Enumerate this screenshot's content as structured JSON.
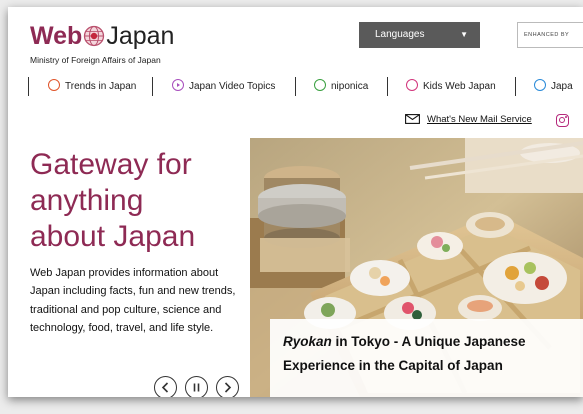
{
  "header": {
    "logo_web": "Web",
    "logo_japan": "Japan",
    "ministry": "Ministry of Foreign Affairs of Japan",
    "languages_label": "Languages",
    "search_label": "ENHANCED BY"
  },
  "nav": {
    "items": [
      {
        "label": "Trends in Japan",
        "icon": "trends-icon",
        "color": "#e0552b"
      },
      {
        "label": "Japan Video Topics",
        "icon": "video-icon",
        "color": "#a84fbd"
      },
      {
        "label": "niponica",
        "icon": "niponica-icon",
        "color": "#3aa040"
      },
      {
        "label": "Kids Web Japan",
        "icon": "kids-icon",
        "color": "#d2357c"
      },
      {
        "label": "Japa",
        "icon": "japan-icon",
        "color": "#2a8ad8"
      }
    ]
  },
  "whatsnew": {
    "label": "What's New Mail Service"
  },
  "hero": {
    "title_lines": [
      "Gateway for",
      "anything",
      "about Japan"
    ],
    "description": "Web Japan provides information about Japan including facts, fun and new trends, traditional and pop culture, science and technology, food, travel, and life style.",
    "caption_emph": "Ryokan",
    "caption_rest1": " in Tokyo - A Unique Japanese",
    "caption_line2": "Experience in the Capital of Japan"
  },
  "colors": {
    "brand": "#8e2a54",
    "language_button": "#5a5a5a",
    "instagram": "#b5287b"
  }
}
